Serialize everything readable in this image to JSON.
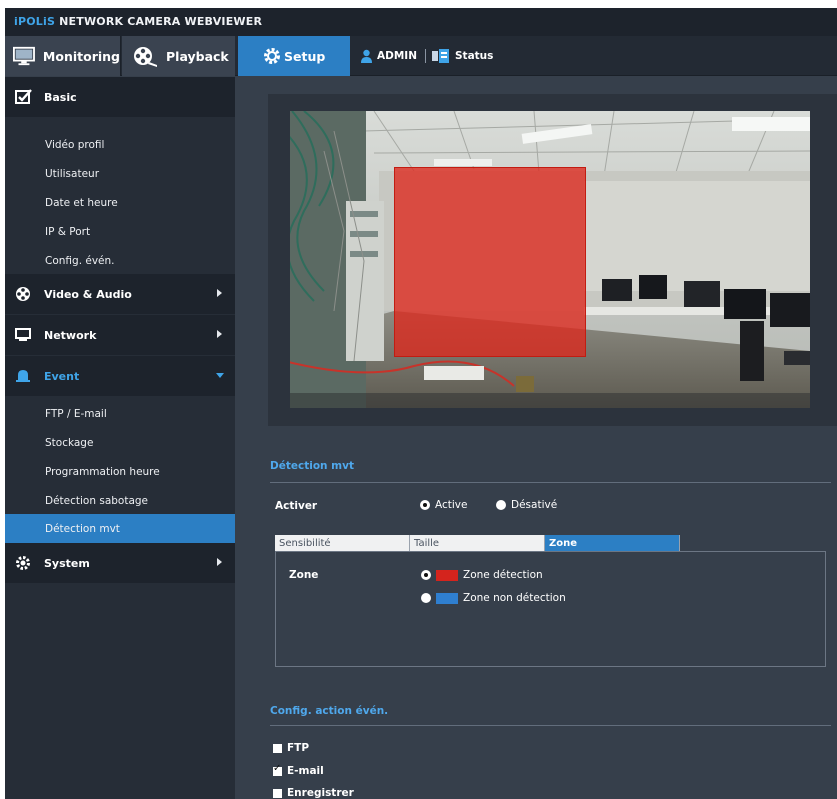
{
  "header": {
    "brand_accent": "iPOLiS",
    "brand_rest": " NETWORK CAMERA WEBVIEWER"
  },
  "nav": {
    "monitoring": "Monitoring",
    "playback": "Playback",
    "setup": "Setup",
    "admin": "ADMIN",
    "status": "Status"
  },
  "sidebar": {
    "basic": {
      "label": "Basic",
      "items": [
        "Vidéo profil",
        "Utilisateur",
        "Date et heure",
        "IP & Port",
        "Config. évén."
      ]
    },
    "video_audio": "Video & Audio",
    "network": "Network",
    "event": {
      "label": "Event",
      "items": [
        "FTP / E-mail",
        "Stockage",
        "Programmation heure",
        "Détection sabotage",
        "Détection mvt"
      ]
    },
    "system": "System"
  },
  "motion": {
    "title": "Détection mvt",
    "activer_label": "Activer",
    "active_label": "Active",
    "desactive_label": "Désativé",
    "tabs": [
      "Sensibilité",
      "Taille",
      "Zone"
    ],
    "zone_label": "Zone",
    "zone_detect_label": "Zone détection",
    "zone_nondetect_label": "Zone non détection"
  },
  "action": {
    "title": "Config. action évén.",
    "items": [
      {
        "label": "FTP",
        "checked": false
      },
      {
        "label": "E-mail",
        "checked": true
      },
      {
        "label": "Enregistrer",
        "checked": false
      }
    ]
  },
  "colors": {
    "accent": "#2c7fc4",
    "detect_zone": "#d4241d",
    "nondetect_zone": "#2f7fd0"
  }
}
